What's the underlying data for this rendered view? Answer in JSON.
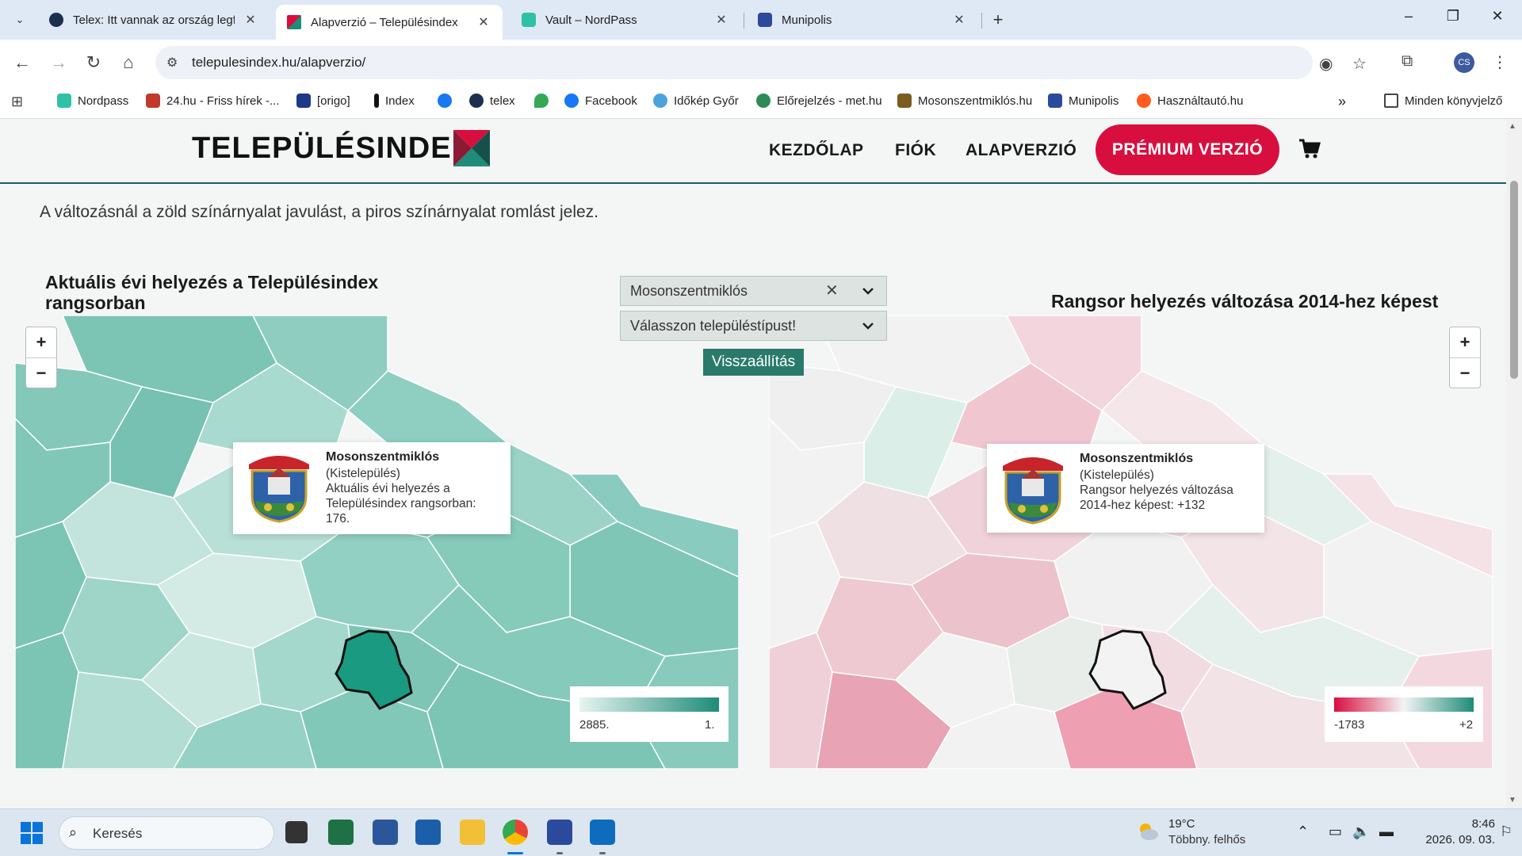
{
  "browser": {
    "tabs": [
      {
        "title": "Telex: Itt vannak az ország legfe",
        "icon": "telex-favicon",
        "color": "#1d2f4f"
      },
      {
        "title": "Alapverzió – Településindex",
        "icon": "telepulesindex-favicon",
        "color": "#d80f3e"
      },
      {
        "title": "Vault – NordPass",
        "icon": "nordpass-favicon",
        "color": "#2fc1a4"
      },
      {
        "title": "Munipolis",
        "icon": "munipolis-favicon",
        "color": "#2b4a9b"
      }
    ],
    "url": "telepulesindex.hu/alapverzio/",
    "profile_initials": "CS",
    "bookmarks": [
      {
        "label": "Nordpass",
        "color": "#2fc1a4"
      },
      {
        "label": "24.hu - Friss hírek -...",
        "color": "#c0392b"
      },
      {
        "label": "[origo]",
        "color": "#1d3a8a"
      },
      {
        "label": "Index",
        "color": "#111111"
      },
      {
        "label": "",
        "color": "#1877f2"
      },
      {
        "label": "telex",
        "color": "#1d2f4f"
      },
      {
        "label": "",
        "color": "#34a853"
      },
      {
        "label": "Facebook",
        "color": "#1877f2"
      },
      {
        "label": "Időkép Győr",
        "color": "#4aa3df"
      },
      {
        "label": "Előrejelzés - met.hu",
        "color": "#2e8b57"
      },
      {
        "label": "Mosonszentmiklós.hu",
        "color": "#7a5c1e"
      },
      {
        "label": "Munipolis",
        "color": "#2b4a9b"
      },
      {
        "label": "Használtautó.hu",
        "color": "#ff5a1f"
      }
    ],
    "all_bookmarks_label": "Minden könyvjelző"
  },
  "site": {
    "logo_text": "TELEPÜLÉSINDE",
    "nav": [
      "KEZDŐLAP",
      "FIÓK",
      "ALAPVERZIÓ"
    ],
    "premium_label": "PRÉMIUM VERZIÓ",
    "info_text": "A változásnál a zöld színárnyalat javulást, a piros színárnyalat romlást jelez.",
    "left_title": "Aktuális évi helyezés a Településindex rangsorban",
    "right_title": "Rangsor helyezés változása 2014-hez képest",
    "settlement_select": "Mosonszentmiklós",
    "type_select_placeholder": "Válasszon településtípust!",
    "reset_label": "Visszaállítás",
    "left_popup": {
      "name": "Mosonszentmiklós",
      "type": "(Kistelepülés)",
      "line1": "Aktuális évi helyezés a",
      "line2": "Településindex rangsorban:",
      "line3": "176."
    },
    "right_popup": {
      "name": "Mosonszentmiklós",
      "type": "(Kistelepülés)",
      "line1": "Rangsor helyezés változása",
      "line2": "2014-hez képest: +132"
    },
    "left_legend": {
      "min": "2885.",
      "max": "1."
    },
    "right_legend": {
      "min": "-1783",
      "max": "+2"
    },
    "colors": {
      "brand_red": "#d80f3e",
      "brand_teal": "#1e8c78",
      "map_green": "#7fc6b7",
      "map_pink": "#f2c9d2"
    }
  },
  "taskbar": {
    "search_placeholder": "Keresés",
    "weather_temp": "19°C",
    "weather_desc": "Többny. felhős",
    "time": "8:46",
    "date": "2026. 09. 03."
  }
}
